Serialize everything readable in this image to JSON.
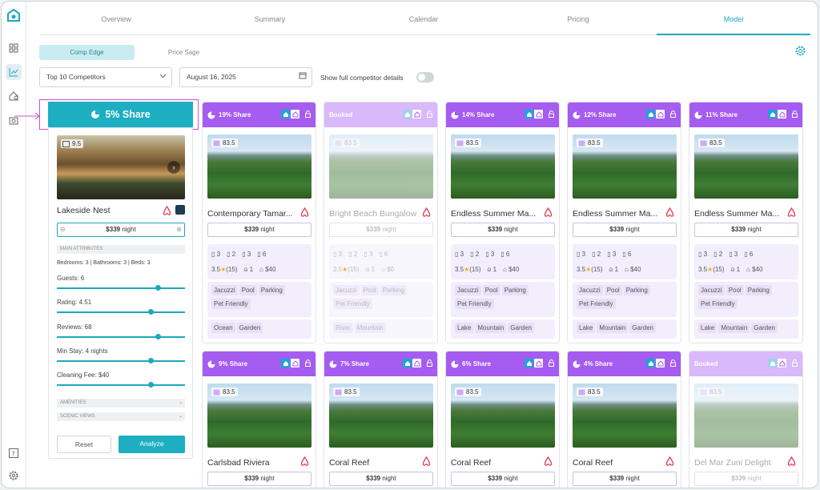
{
  "tabs": [
    "Overview",
    "Summary",
    "Calendar",
    "Pricing",
    "Model"
  ],
  "subtabs": [
    "Comp Edge",
    "Price Sage"
  ],
  "filters": {
    "competitors": "Top 10 Competitors",
    "date": "August 16, 2025",
    "toggle_label": "Show full competitor details"
  },
  "my_listing": {
    "share": "5% Share",
    "score": "9.5",
    "name": "Lakeside Nest",
    "price": "$339",
    "price_unit": "night",
    "main_attributes": "MAIN ATTRIBUTES",
    "summary": "Bedrooms: 3 | Bathrooms: 3 | Beds: 3",
    "sliders": [
      {
        "label": "Guests: 6",
        "level": 0.79
      },
      {
        "label": "Rating: 4.51",
        "level": 0.73
      },
      {
        "label": "Reviews: 68",
        "level": 0.79
      },
      {
        "label": "Min Stay: 4 nights",
        "level": 0.73
      },
      {
        "label": "Cleaning Fee: $40",
        "level": 0.73
      }
    ],
    "amenities": "AMENITIES",
    "scenic": "SCENIC VIEWS",
    "reset": "Reset",
    "analyze": "Analyze"
  },
  "competitors": [
    {
      "share": "19% Share",
      "booked": false,
      "score": "83.5",
      "name": "Contemporary Tamar...",
      "price": "$339",
      "unit": "night",
      "beds": "3",
      "baths": "2",
      "cars": "3",
      "guests": "6",
      "rating": "3.5",
      "reviews": "(15)",
      "minstay": "1",
      "fee": "$40",
      "amenities": [
        "Jacuzzi",
        "Pool",
        "Parking",
        "Pet Friendly"
      ],
      "views": [
        "Ocean",
        "Garden"
      ]
    },
    {
      "share": "Booked",
      "booked": true,
      "score": "83.5",
      "name": "Bright Beach Bungalow",
      "price": "$339",
      "unit": "night",
      "beds": "3",
      "baths": "2",
      "cars": "3",
      "guests": "6",
      "rating": "3.5",
      "reviews": "(15)",
      "minstay": "1",
      "fee": "$0",
      "amenities": [
        "Jacuzzi",
        "Pool",
        "Parking",
        "Pet Friendly"
      ],
      "views": [
        "River",
        "Mountain"
      ]
    },
    {
      "share": "14% Share",
      "booked": false,
      "score": "83.5",
      "name": "Endless Summer Ma...",
      "price": "$339",
      "unit": "night",
      "beds": "3",
      "baths": "2",
      "cars": "3",
      "guests": "6",
      "rating": "3.5",
      "reviews": "(15)",
      "minstay": "1",
      "fee": "$40",
      "amenities": [
        "Jacuzzi",
        "Pool",
        "Parking",
        "Pet Friendly"
      ],
      "views": [
        "Lake",
        "Mountain",
        "Garden"
      ]
    },
    {
      "share": "12% Share",
      "booked": false,
      "score": "83.5",
      "name": "Endless Summer Ma...",
      "price": "$339",
      "unit": "night",
      "beds": "3",
      "baths": "2",
      "cars": "3",
      "guests": "6",
      "rating": "3.5",
      "reviews": "(15)",
      "minstay": "1",
      "fee": "$40",
      "amenities": [
        "Jacuzzi",
        "Pool",
        "Parking",
        "Pet Friendly"
      ],
      "views": [
        "Lake",
        "Mountain",
        "Garden"
      ]
    },
    {
      "share": "11% Share",
      "booked": false,
      "score": "83.5",
      "name": "Endless Summer Ma...",
      "price": "$339",
      "unit": "night",
      "beds": "3",
      "baths": "2",
      "cars": "3",
      "guests": "6",
      "rating": "3.5",
      "reviews": "(15)",
      "minstay": "1",
      "fee": "$40",
      "amenities": [
        "Jacuzzi",
        "Pool",
        "Parking",
        "Pet Friendly"
      ],
      "views": [
        "Lake",
        "Mountain",
        "Garden"
      ]
    },
    {
      "share": "9% Share",
      "booked": false,
      "score": "83.5",
      "name": "Carlsbad Riviera",
      "price": "$339",
      "unit": "night"
    },
    {
      "share": "7% Share",
      "booked": false,
      "score": "83.5",
      "name": "Coral Reef",
      "price": "$339",
      "unit": "night"
    },
    {
      "share": "6% Share",
      "booked": false,
      "score": "83.5",
      "name": "Coral Reef",
      "price": "$339",
      "unit": "night"
    },
    {
      "share": "4% Share",
      "booked": false,
      "score": "83.5",
      "name": "Coral Reef",
      "price": "$339",
      "unit": "night"
    },
    {
      "share": "Booked",
      "booked": true,
      "score": "83.5",
      "name": "Del Mar Zuni Delight",
      "price": "$339",
      "unit": "night"
    }
  ],
  "colors": {
    "teal": "#1dafc1",
    "purple": "#a55cf0",
    "booked": "#d9b8fb",
    "highlight": "#d14fcd"
  }
}
